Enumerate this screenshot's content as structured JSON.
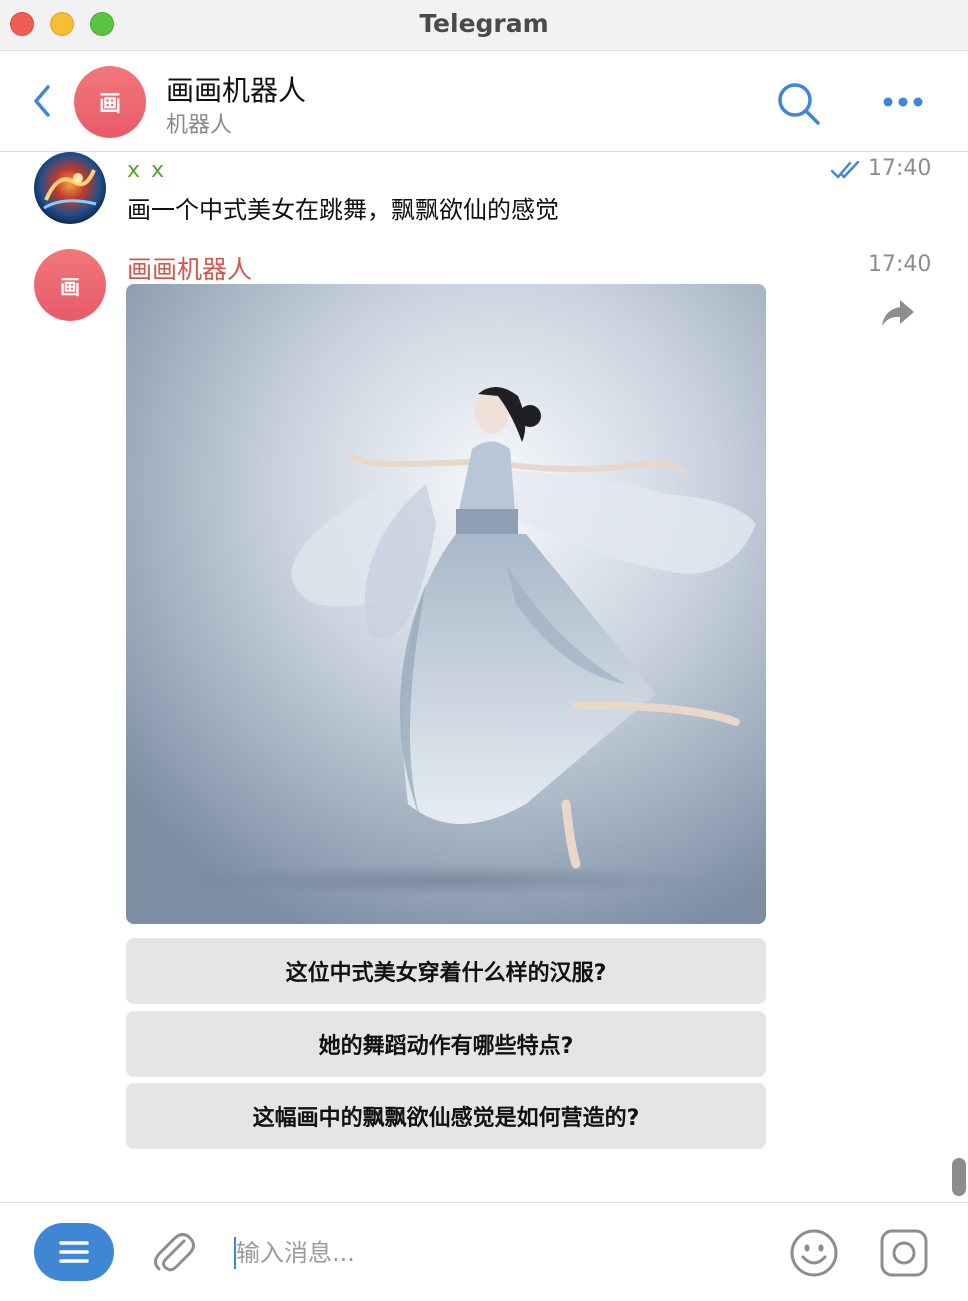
{
  "window": {
    "title": "Telegram"
  },
  "header": {
    "avatar_letter": "画",
    "name": "画画机器人",
    "subtitle": "机器人"
  },
  "messages": [
    {
      "sender": "x x",
      "text": "画一个中式美女在跳舞，飘飘欲仙的感觉",
      "time": "17:40",
      "status": "read"
    },
    {
      "sender": "画画机器人",
      "avatar_letter": "画",
      "time": "17:40",
      "image_alt": "dancer-in-hanfu",
      "inline_buttons": [
        "这位中式美女穿着什么样的汉服?",
        "她的舞蹈动作有哪些特点?",
        "这幅画中的飘飘欲仙感觉是如何营造的?"
      ]
    }
  ],
  "composer": {
    "placeholder": "输入消息..."
  },
  "colors": {
    "accent": "#3f86d4",
    "bot_name": "#d0574f",
    "user_name": "#5aa233",
    "button_bg": "#e5e5e5"
  }
}
